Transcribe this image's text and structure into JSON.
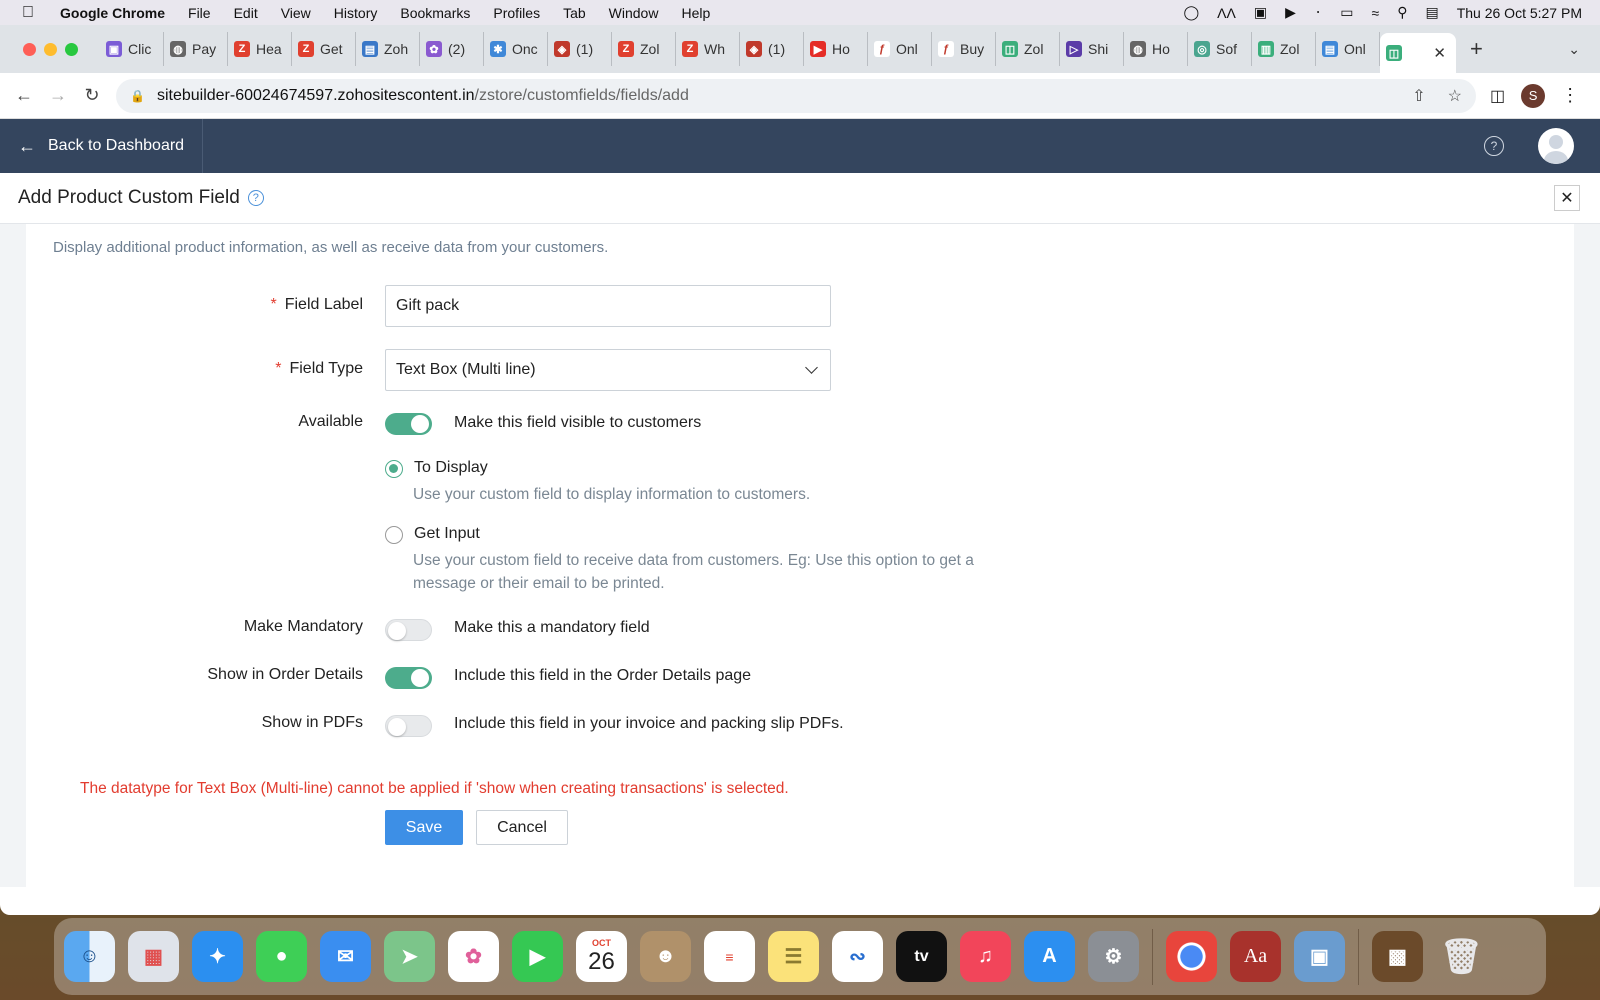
{
  "menubar": {
    "items": [
      "Google Chrome",
      "File",
      "Edit",
      "View",
      "History",
      "Bookmarks",
      "Profiles",
      "Tab",
      "Window",
      "Help"
    ],
    "datetime": "Thu 26 Oct  5:27 PM"
  },
  "browser": {
    "tabs": [
      {
        "label": "Clic",
        "color": "#7b5cd6",
        "glyph": "▣"
      },
      {
        "label": "Pay",
        "color": "#666666",
        "glyph": "◍"
      },
      {
        "label": "Hea",
        "color": "#e0402f",
        "glyph": "Z"
      },
      {
        "label": "Get",
        "color": "#e0402f",
        "glyph": "Z"
      },
      {
        "label": "Zoh",
        "color": "#3a78c8",
        "glyph": "▤"
      },
      {
        "label": "(2)",
        "color": "#8a5ad0",
        "glyph": "✿"
      },
      {
        "label": "Onc",
        "color": "#3f88d8",
        "glyph": "✱"
      },
      {
        "label": "(1)",
        "color": "#c0392b",
        "glyph": "◈"
      },
      {
        "label": "Zol",
        "color": "#e0402f",
        "glyph": "Z"
      },
      {
        "label": "Wh",
        "color": "#e0402f",
        "glyph": "Z"
      },
      {
        "label": "(1)",
        "color": "#c0392b",
        "glyph": "◈"
      },
      {
        "label": "Ho",
        "color": "#e52d27",
        "glyph": "▶"
      },
      {
        "label": "Onl",
        "color": "#ffffff",
        "glyph": "ƒ"
      },
      {
        "label": "Buy",
        "color": "#ffffff",
        "glyph": "ƒ"
      },
      {
        "label": "Zol",
        "color": "#3bae7c",
        "glyph": "◫"
      },
      {
        "label": "Shi",
        "color": "#5b3ca8",
        "glyph": "▷"
      },
      {
        "label": "Ho",
        "color": "#666666",
        "glyph": "◍"
      },
      {
        "label": "Sof",
        "color": "#4aa58f",
        "glyph": "◎"
      },
      {
        "label": "Zol",
        "color": "#3bae7c",
        "glyph": "▥"
      },
      {
        "label": "Onl",
        "color": "#3f88d8",
        "glyph": "▤"
      }
    ],
    "active_tab_icon": "shopping-bag",
    "url_host": "sitebuilder-60024674597.zohositescontent.in",
    "url_path": "/zstore/customfields/fields/add",
    "profile_initial": "S"
  },
  "app": {
    "back_label": "Back to Dashboard",
    "page_title": "Add Product Custom Field",
    "description": "Display additional product information, as well as receive data from your customers."
  },
  "form": {
    "field_label": {
      "label": "Field Label",
      "value": "Gift pack"
    },
    "field_type": {
      "label": "Field Type",
      "value": "Text Box (Multi line)"
    },
    "available": {
      "label": "Available",
      "desc": "Make this field visible to customers",
      "on": true
    },
    "radio_display": {
      "label": "To Display",
      "help": "Use your custom field to display information to customers.",
      "selected": true
    },
    "radio_input": {
      "label": "Get Input",
      "help": "Use your custom field to receive data from customers. Eg: Use this option to get a message or their email to be printed.",
      "selected": false
    },
    "mandatory": {
      "label": "Make Mandatory",
      "desc": "Make this a mandatory field",
      "on": false
    },
    "order_details": {
      "label": "Show in Order Details",
      "desc": "Include this field in the Order Details page",
      "on": true
    },
    "pdfs": {
      "label": "Show in PDFs",
      "desc": "Include this field in your invoice and packing slip PDFs.",
      "on": false
    },
    "error": "The datatype for Text Box (Multi-line) cannot be applied if 'show when creating transactions' is selected.",
    "save_label": "Save",
    "cancel_label": "Cancel",
    "required_mark": "*"
  },
  "dock": {
    "calendar_month": "OCT",
    "calendar_day": "26",
    "tv_label": "tv",
    "dictionary_label": "Aa"
  }
}
